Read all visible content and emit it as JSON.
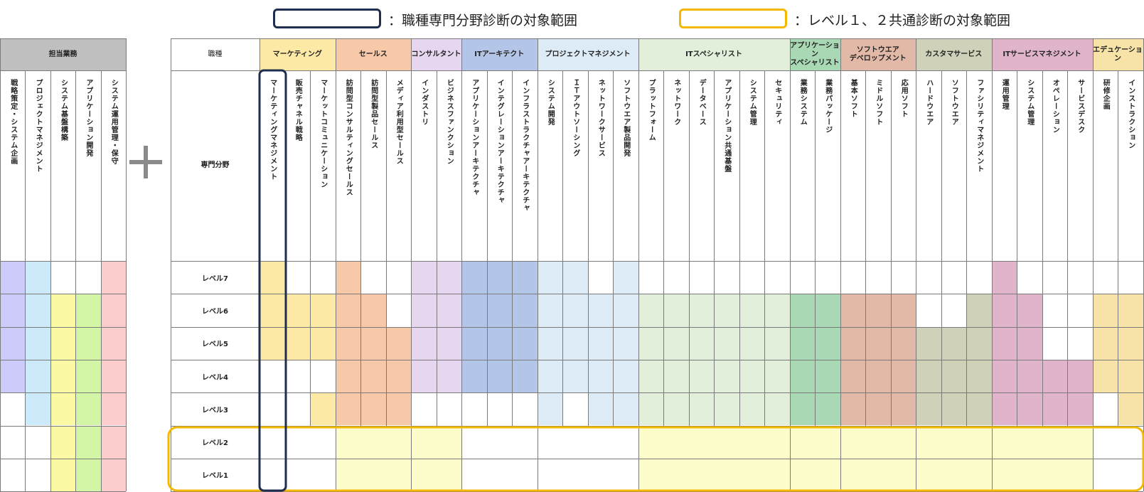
{
  "legend": {
    "item1": "：職種専門分野診断の対象範囲",
    "item2": "：レベル１、２共通診断の対象範囲",
    "item1_color": "#1f2d4f",
    "item2_color": "#f5b800"
  },
  "left_table": {
    "title": "担当業務",
    "columns": [
      {
        "label": "戦略策定・システム企画",
        "color": "#cccbf9",
        "from_level": 4
      },
      {
        "label": "プロジェクトマネジメント",
        "color": "#cdeafb",
        "from_level": 3
      },
      {
        "label": "システム基盤構築",
        "color": "#fbf9a3",
        "from_level": 1,
        "to_level": 6
      },
      {
        "label": "アプリケーション開発",
        "color": "#d3f6a6",
        "from_level": 1,
        "to_level": 6
      },
      {
        "label": "システム運用管理・保守",
        "color": "#fdcdcd",
        "from_level": 1
      }
    ]
  },
  "main_table": {
    "job_header": "職種",
    "specialty_header": "専門分野",
    "levels": [
      "レベル7",
      "レベル6",
      "レベル5",
      "レベル4",
      "レベル3",
      "レベル2",
      "レベル1"
    ],
    "level1_2_color": "#fdfccb",
    "jobs": [
      {
        "name": "マーケティング",
        "color": "#fde9a6",
        "specialties": [
          {
            "name": "マーケティングマネジメント",
            "levels": [
              7,
              6,
              5
            ]
          },
          {
            "name": "販売チャネル戦略",
            "levels": [
              6,
              5
            ]
          },
          {
            "name": "マーケットコミュニケーション",
            "levels": [
              6,
              5,
              3
            ]
          }
        ]
      },
      {
        "name": "セールス",
        "color": "#f8c9a8",
        "specialties": [
          {
            "name": "訪問型コンサルティングセールス",
            "levels": [
              7,
              6,
              5,
              4,
              3
            ]
          },
          {
            "name": "訪問型製品セールス",
            "levels": [
              6,
              5,
              4,
              3
            ]
          },
          {
            "name": "メディア利用型セールス",
            "levels": [
              5,
              4,
              3
            ]
          }
        ]
      },
      {
        "name": "コンサルタント",
        "color": "#e6d6ef",
        "specialties": [
          {
            "name": "インダストリ",
            "levels": [
              7,
              6,
              5,
              4
            ]
          },
          {
            "name": "ビジネスファンクション",
            "levels": [
              7,
              6,
              5,
              4
            ]
          }
        ]
      },
      {
        "name": "ITアーキテクト",
        "color": "#b4c6e7",
        "specialties": [
          {
            "name": "アプリケーションアーキテクチャ",
            "levels": [
              7,
              6,
              5,
              4
            ]
          },
          {
            "name": "インテグレーションアーキテクチャ",
            "levels": [
              7,
              6,
              5,
              4
            ]
          },
          {
            "name": "インフラストラクチャアーキテクチャ",
            "levels": [
              7,
              6,
              5,
              4
            ]
          }
        ]
      },
      {
        "name": "プロジェクトマネジメント",
        "color": "#ddebf7",
        "specialties": [
          {
            "name": "システム開発",
            "levels": [
              7,
              6,
              5,
              4,
              3
            ]
          },
          {
            "name": "ＩＴアウトソーシング",
            "levels": [
              7,
              6,
              5,
              4
            ]
          },
          {
            "name": "ネットワークサービス",
            "levels": [
              6,
              5,
              4,
              3
            ]
          },
          {
            "name": "ソフトウエア製品開発",
            "levels": [
              7,
              6,
              5,
              4,
              3
            ]
          }
        ]
      },
      {
        "name": "ITスペシャリスト",
        "color": "#e2efda",
        "specialties": [
          {
            "name": "プラットフォーム",
            "levels": [
              6,
              5,
              4,
              3
            ]
          },
          {
            "name": "ネットワーク",
            "levels": [
              6,
              5,
              4,
              3
            ]
          },
          {
            "name": "データベース",
            "levels": [
              6,
              5,
              4,
              3
            ]
          },
          {
            "name": "アプリケーション共通基盤",
            "levels": [
              6,
              5,
              4,
              3
            ]
          },
          {
            "name": "システム管理",
            "levels": [
              6,
              5,
              4,
              3
            ]
          },
          {
            "name": "セキュリティ",
            "levels": [
              6,
              5,
              4,
              3
            ]
          }
        ]
      },
      {
        "name": "アプリケーション\nスペシャリスト",
        "color": "#a9d8b4",
        "specialties": [
          {
            "name": "業務システム",
            "levels": [
              6,
              5,
              4,
              3
            ]
          },
          {
            "name": "業務パッケージ",
            "levels": [
              6,
              5,
              4,
              3
            ]
          }
        ]
      },
      {
        "name": "ソフトウエア\nデベロップメント",
        "color": "#e2b8a6",
        "specialties": [
          {
            "name": "基本ソフト",
            "levels": [
              6,
              5,
              4,
              3
            ]
          },
          {
            "name": "ミドルソフト",
            "levels": [
              6,
              5,
              4,
              3
            ]
          },
          {
            "name": "応用ソフト",
            "levels": [
              6,
              5,
              4,
              3
            ]
          }
        ]
      },
      {
        "name": "カスタマサービス",
        "color": "#cfd2b8",
        "specialties": [
          {
            "name": "ハードウエア",
            "levels": [
              5,
              4,
              3
            ]
          },
          {
            "name": "ソフトウエア",
            "levels": [
              5,
              4,
              3
            ]
          },
          {
            "name": "ファシリティマネジメント",
            "levels": [
              6,
              5,
              4,
              3
            ]
          }
        ]
      },
      {
        "name": "ITサービスマネジメント",
        "color": "#e0b5cb",
        "specialties": [
          {
            "name": "運用管理",
            "levels": [
              7,
              6,
              5,
              4,
              3
            ]
          },
          {
            "name": "システム管理",
            "levels": [
              6,
              5,
              4,
              3
            ]
          },
          {
            "name": "オペレーション",
            "levels": [
              4,
              3
            ]
          },
          {
            "name": "サービスデスク",
            "levels": [
              4,
              3
            ]
          }
        ]
      },
      {
        "name": "エデュケーション",
        "color": "#f7e3a8",
        "specialties": [
          {
            "name": "研修企画",
            "levels": [
              6,
              5,
              4
            ]
          },
          {
            "name": "インストラクション",
            "levels": [
              6,
              5,
              4,
              3
            ]
          }
        ]
      }
    ]
  }
}
